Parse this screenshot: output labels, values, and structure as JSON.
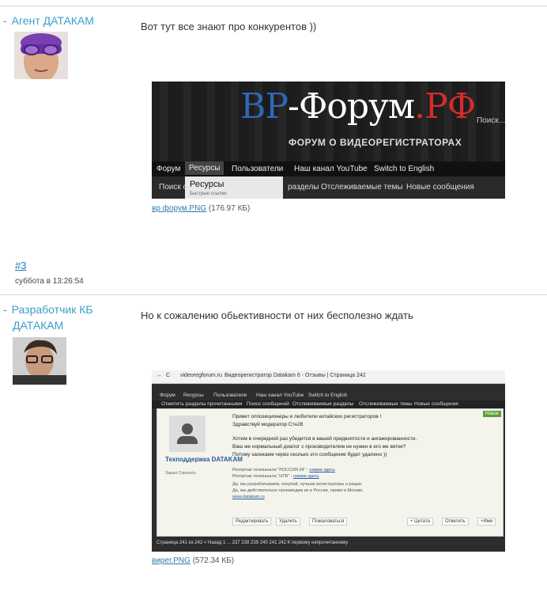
{
  "posts": [
    {
      "author": "Агент ДАТАКАМ",
      "message": "Вот тут все знают про конкурентов ))",
      "attachment": {
        "name": "вр форум.PNG",
        "size": "(176.97 КБ)"
      }
    },
    {
      "author_line1": "Разработчик КБ",
      "author_line2": "ДАТАКАМ",
      "anchor": "#3",
      "date": "суббота в 13:26:54",
      "message": "Но к сожалению обьективности от них бесполезно ждать",
      "attachment": {
        "name": "вирег.PNG",
        "size": "(572.34 КБ)"
      }
    }
  ],
  "shot1": {
    "logo_b": "ВР",
    "logo_mid": "-Форум",
    "logo_r": ".РФ",
    "subtitle": "ФОРУМ О ВИДЕОРЕГИСТРАТОРАХ",
    "search": "Поиск...",
    "nav": [
      "Форум",
      "Ресурсы",
      "Пользователи",
      "Наш канал YouTube",
      "Switch to English"
    ],
    "subnav": [
      "Поиск с",
      "разделы",
      "Отслеживаемые темы",
      "Новые сообщения"
    ],
    "dropdown_title": "Ресурсы",
    "dropdown_sub": "Быстрые ссылки"
  },
  "shot2": {
    "url": "videoregforum.ru",
    "tab": "Видеорегистратор Datakam 6 - Отзывы | Страница 242",
    "nav": [
      "Форум",
      "Ресурсы",
      "Пользователи",
      "Наш канал YouTube",
      "Switch to English"
    ],
    "subnav": [
      "Отметить разделы прочитанными",
      "Поиск сообщений",
      "Отслеживаемые разделы",
      "Отслеживаемые темы",
      "Новые сообщения"
    ],
    "badge": "Новое",
    "username": "Техподдержка DATAKAM",
    "user_title": "Зашел Спросить",
    "lines": [
      "Привет оппозиционеры и любители китайских регистраторов !",
      "Здравствуй модератор Стн28",
      "Хотим в очередной раз убедится в вашей предвзятости и ангажированности.",
      "Ваш же нормальный диалог с производителем не нужен в его же ветке?",
      "Потому засекаем через сколько это сообщение будет удалено ))"
    ],
    "small_lines": [
      "Репортаж телеканала \"РОССИЯ 24\" -",
      "Репортаж телеканала \"НТВ\" -",
      "Да, мы разрабатываем, покупай, лучшие регистраторы и рации.",
      "Да, мы действительно производим их в России, прямо в Москве.",
      "www.datakam.ru"
    ],
    "link_here": "нажми здесь",
    "buttons": [
      "Редактировать",
      "Удалить",
      "Пожаловаться",
      "+ Цитата",
      "Ответить",
      "+Имя"
    ],
    "pager": "Страница 241 из 242   < Назад   1  ...  237  238  239  240  241  242   К первому непрочитанному"
  }
}
